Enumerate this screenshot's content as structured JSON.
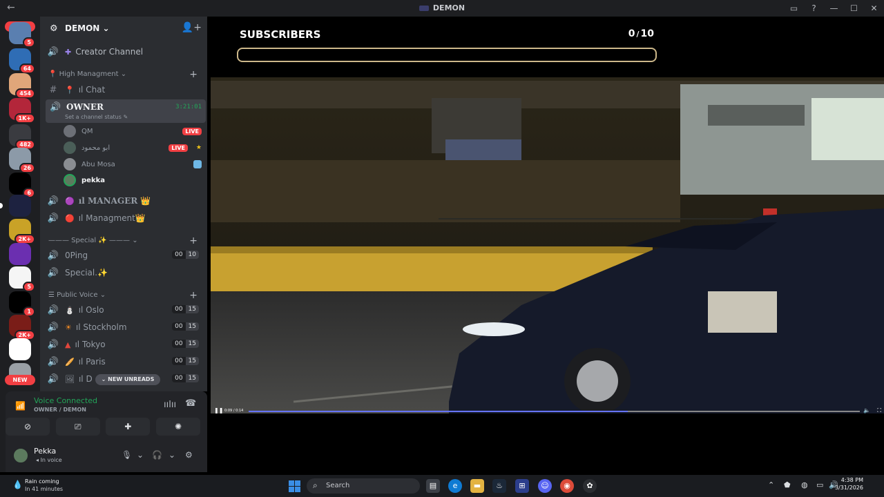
{
  "window": {
    "title": "DEMON",
    "back": "←",
    "controls": [
      "▭",
      "?",
      "—",
      "☐",
      "✕"
    ]
  },
  "rail": {
    "new_top": "NEW",
    "new_bottom": "NEW",
    "servers": [
      {
        "badge": "5",
        "color": "#5a7fb0"
      },
      {
        "badge": "64",
        "color": "#2f6db5"
      },
      {
        "badge": "454",
        "color": "#e0a67a"
      },
      {
        "badge": "1K+",
        "color": "#b3263a"
      },
      {
        "badge": "482",
        "color": "#3a3b40"
      },
      {
        "badge": "26",
        "color": "#8c9aa8"
      },
      {
        "badge": "6",
        "color": "#000000"
      },
      {
        "badge": "",
        "color": "#1d2240"
      },
      {
        "badge": "2K+",
        "color": "#c9a227"
      },
      {
        "badge": "",
        "color": "#6b2fb0"
      },
      {
        "badge": "5",
        "color": "#f5f5f5"
      },
      {
        "badge": "1",
        "color": "#000000"
      },
      {
        "badge": "2K+",
        "color": "#7a1d18"
      },
      {
        "badge": "",
        "color": "#ffffff"
      },
      {
        "badge": "",
        "color": "#9aa0a6"
      }
    ]
  },
  "guild": {
    "name": "DEMON"
  },
  "channels": {
    "creator": "Creator Channel",
    "cat_high": "📍 High Managment",
    "chat": "ıl Chat",
    "owner": {
      "name": "OWNER",
      "status": "Set a channel status",
      "timer": "3:21:01"
    },
    "users": [
      {
        "name": "QM",
        "tag": "LIVE"
      },
      {
        "name": "ابو محمود",
        "tag": "LIVE"
      },
      {
        "name": "Abu Mosa",
        "tag": ""
      },
      {
        "name": "pekka",
        "tag": ""
      }
    ],
    "manager": "ıl MANAGER 👑",
    "managment": "ıl Managment👑",
    "cat_special": "——— Special ✨ ———",
    "oping": {
      "name": "0Ping",
      "a": "00",
      "b": "10"
    },
    "special": "Special.✨",
    "cat_public": "Public Voice",
    "public": [
      {
        "name": "ıl Oslo",
        "a": "00",
        "b": "15"
      },
      {
        "name": "ıl Stockholm",
        "a": "00",
        "b": "15"
      },
      {
        "name": "ıl Tokyo",
        "a": "00",
        "b": "15"
      },
      {
        "name": "ıl Paris",
        "a": "00",
        "b": "15"
      },
      {
        "name": "ıl D",
        "a": "00",
        "b": "15"
      }
    ],
    "new_unreads": "NEW UNREADS"
  },
  "voice": {
    "title": "Voice Connected",
    "sub": "OWNER / DEMON"
  },
  "user": {
    "name": "Pekka",
    "status": "In voice"
  },
  "stream": {
    "label": "SUBSCRIBERS",
    "count": "0",
    "sep": "/",
    "goal": "10",
    "progress_fraction": 0.0,
    "time": "0:09 / 0:14",
    "played_fraction": 0.62
  },
  "taskbar": {
    "weather_title": "Rain coming",
    "weather_sub": "In 41 minutes",
    "search": "Search",
    "time": "4:38 PM",
    "date": "3/31/2026"
  },
  "colors": {
    "accent": "#5865f2",
    "green": "#23a559",
    "red": "#f23f43",
    "gold": "#cdb88a"
  }
}
